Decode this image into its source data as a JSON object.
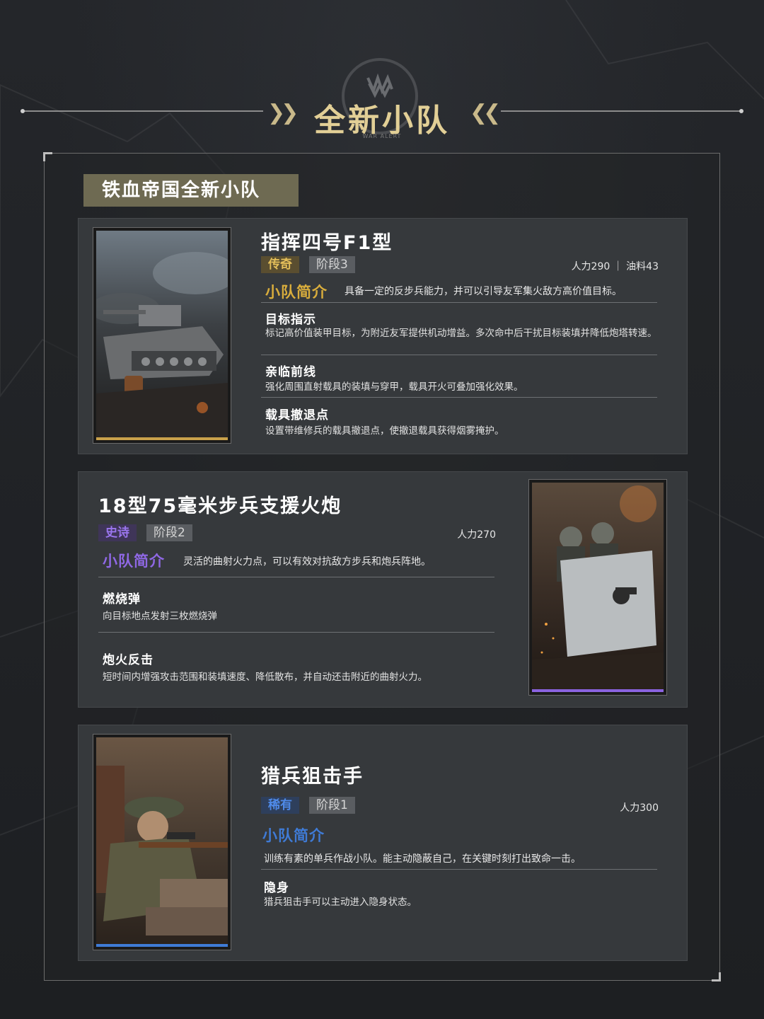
{
  "header": {
    "title": "全新小队",
    "emblem_tag": "WAR ALERT"
  },
  "section": {
    "title": "铁血帝国全新小队"
  },
  "colors": {
    "legendary": "#c9a14a",
    "epic": "#8a63e0",
    "rare": "#3f7bd6",
    "accent_gold": "#e2cf96"
  },
  "units": [
    {
      "name": "指挥四号F1型",
      "rarity": "传奇",
      "stage": "阶段3",
      "cost": "人力290 ｜ 油料43",
      "intro_label": "小队简介",
      "intro_text": "具备一定的反步兵能力，并可以引导友军集火敌方高价值目标。",
      "image": "tank-illustration",
      "skills": [
        {
          "name": "目标指示",
          "desc": "标记高价值装甲目标，为附近友军提供机动增益。多次命中后干扰目标装填并降低炮塔转速。"
        },
        {
          "name": "亲临前线",
          "desc": "强化周围直射载具的装填与穿甲，载具开火可叠加强化效果。"
        },
        {
          "name": "载具撤退点",
          "desc": "设置带维修兵的载具撤退点，使撤退载具获得烟雾掩护。"
        }
      ]
    },
    {
      "name": "18型75毫米步兵支援火炮",
      "rarity": "史诗",
      "stage": "阶段2",
      "cost": "人力270",
      "intro_label": "小队简介",
      "intro_text": "灵活的曲射火力点，可以有效对抗敌方步兵和炮兵阵地。",
      "image": "artillery-crew-illustration",
      "skills": [
        {
          "name": "燃烧弹",
          "desc": "向目标地点发射三枚燃烧弹"
        },
        {
          "name": "炮火反击",
          "desc": "短时间内增强攻击范围和装填速度、降低散布，并自动还击附近的曲射火力。"
        }
      ]
    },
    {
      "name": "猎兵狙击手",
      "rarity": "稀有",
      "stage": "阶段1",
      "cost": "人力300",
      "intro_label": "小队简介",
      "intro_text": "训练有素的单兵作战小队。能主动隐蔽自己，在关键时刻打出致命一击。",
      "image": "sniper-illustration",
      "skills": [
        {
          "name": "隐身",
          "desc": "猎兵狙击手可以主动进入隐身状态。"
        }
      ]
    }
  ]
}
